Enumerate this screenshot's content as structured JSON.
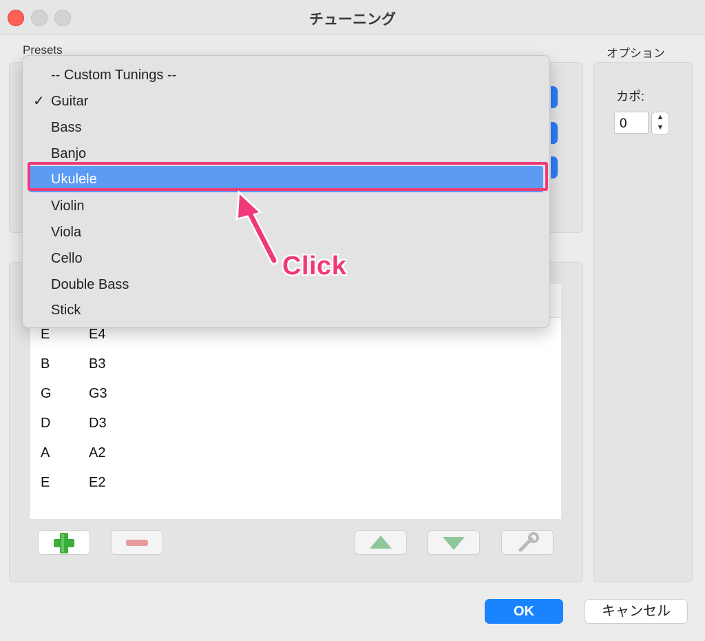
{
  "window": {
    "title": "チューニング"
  },
  "presets": {
    "label": "Presets"
  },
  "options": {
    "label": "オプション",
    "capo_label": "カポ:",
    "capo_value": "0"
  },
  "dropdown": {
    "items": [
      {
        "label": "-- Custom Tunings --",
        "checked": false
      },
      {
        "label": "Guitar",
        "checked": true
      },
      {
        "label": "Bass",
        "checked": false
      },
      {
        "label": "Banjo",
        "checked": false
      },
      {
        "label": "Ukulele",
        "checked": false,
        "highlighted": true
      },
      {
        "label": "Violin",
        "checked": false
      },
      {
        "label": "Viola",
        "checked": false
      },
      {
        "label": "Cello",
        "checked": false
      },
      {
        "label": "Double Bass",
        "checked": false
      },
      {
        "label": "Stick",
        "checked": false
      }
    ],
    "check_mark": "✓"
  },
  "strings_table": {
    "rows": [
      {
        "name": "E",
        "note": "E4"
      },
      {
        "name": "B",
        "note": "B3"
      },
      {
        "name": "G",
        "note": "G3"
      },
      {
        "name": "D",
        "note": "D3"
      },
      {
        "name": "A",
        "note": "A2"
      },
      {
        "name": "E",
        "note": "E2"
      }
    ]
  },
  "toolbar": {
    "add_icon": "plus-icon",
    "remove_icon": "minus-icon",
    "up_icon": "arrow-up-icon",
    "down_icon": "arrow-down-icon",
    "edit_icon": "wrench-icon"
  },
  "buttons": {
    "ok_label": "OK",
    "cancel_label": "キャンセル"
  },
  "annotation": {
    "text": "Click",
    "color": "#f0397a"
  },
  "colors": {
    "accent": "#1a84ff",
    "menu_highlight": "#5b9bf3",
    "annotation": "#f0397a"
  }
}
